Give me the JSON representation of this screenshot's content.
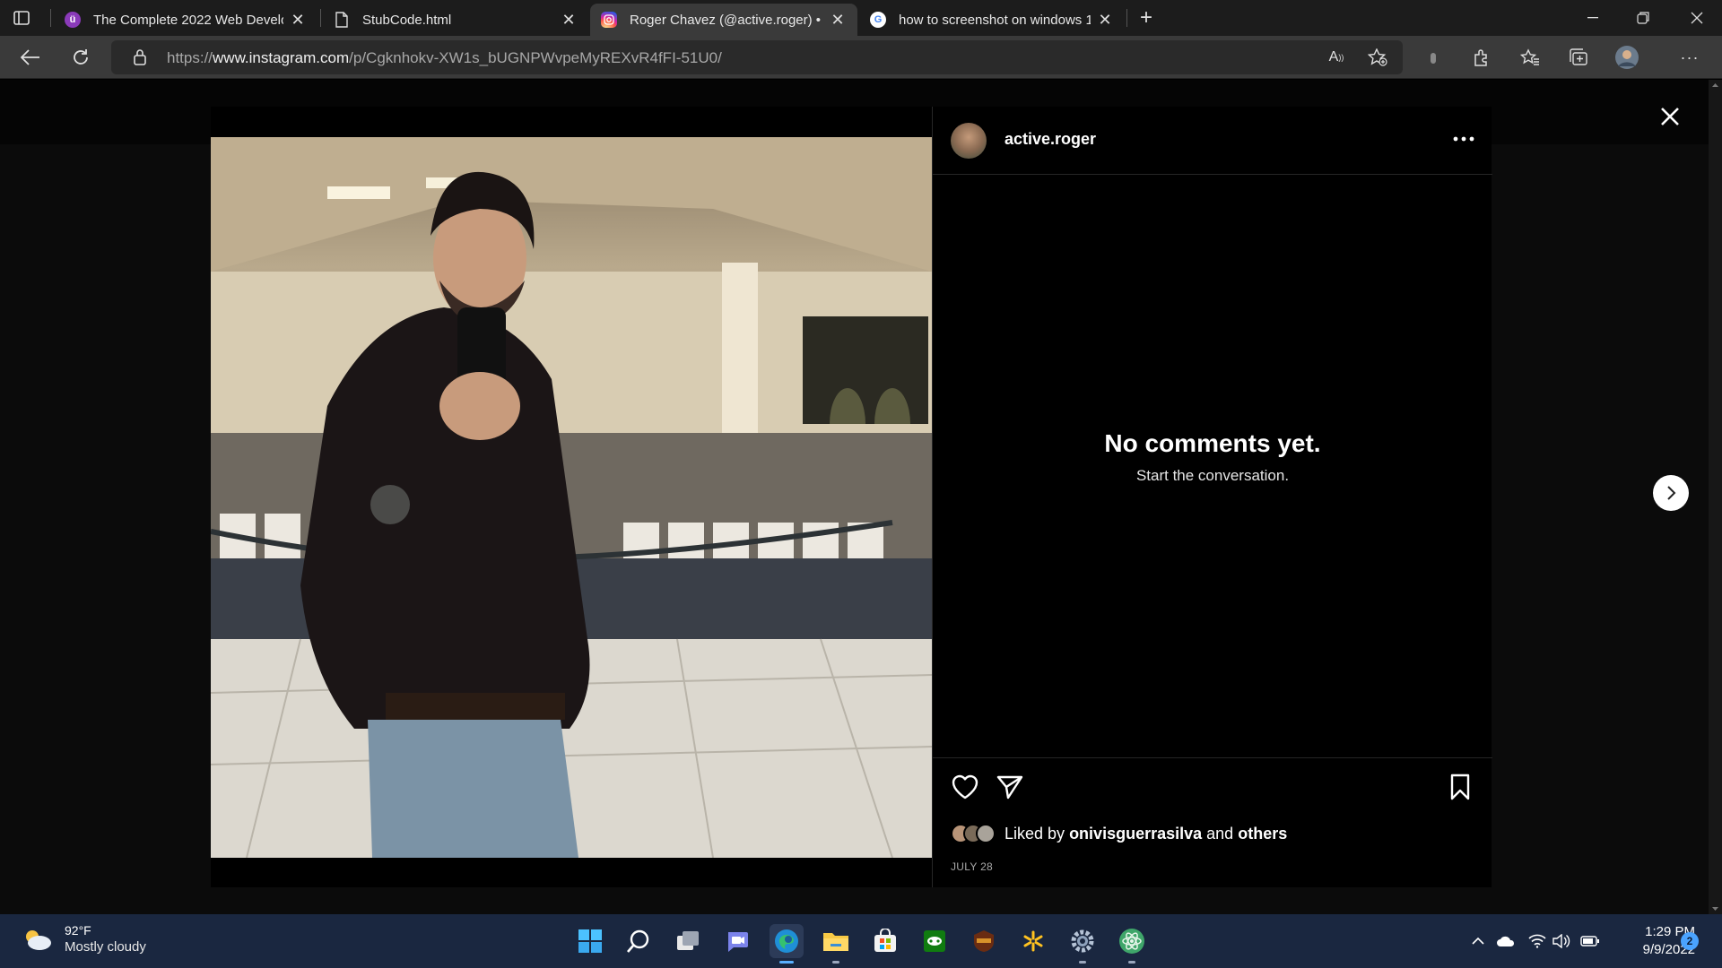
{
  "browser": {
    "tabs": [
      {
        "title": "The Complete 2022 Web Develop",
        "favicon": "udemy-icon",
        "active": false
      },
      {
        "title": "StubCode.html",
        "favicon": "file-icon",
        "active": false
      },
      {
        "title": "Roger Chavez (@active.roger) • I",
        "favicon": "instagram-icon",
        "active": true
      },
      {
        "title": "how to screenshot on windows 1",
        "favicon": "google-icon",
        "active": false
      }
    ],
    "url_prefix": "https://",
    "url_domain": "www.instagram.com",
    "url_path": "/p/Cgknhokv-XW1s_bUGNPWvpeMyREXvR4fFI-51U0/",
    "accent": "#8a3ab9"
  },
  "post": {
    "username": "active.roger",
    "more_label": "•••",
    "empty_title": "No comments yet.",
    "empty_subtitle": "Start the conversation.",
    "liked_by_prefix": "Liked by",
    "liked_by_user": "onivisguerrasilva",
    "liked_by_and": "and",
    "liked_by_others": "others",
    "date": "JULY 28"
  },
  "taskbar": {
    "weather_temp": "92°F",
    "weather_condition": "Mostly cloudy",
    "time": "1:29 PM",
    "date": "9/9/2022",
    "notifications": "2",
    "apps": [
      "start-icon",
      "search-icon",
      "task-view-icon",
      "teams-chat-icon",
      "edge-icon",
      "file-explorer-icon",
      "store-icon",
      "gamepass-icon",
      "forge-icon",
      "walmart-icon",
      "settings-icon",
      "atom-icon"
    ]
  }
}
